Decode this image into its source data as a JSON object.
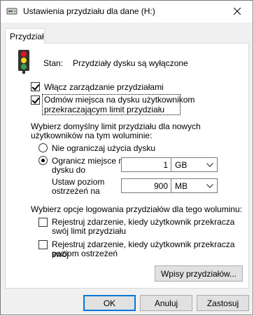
{
  "window": {
    "title": "Ustawienia przydziału dla dane (H:)",
    "close_label": "✕"
  },
  "tabs": [
    {
      "label": "Przydział",
      "active": true
    }
  ],
  "status": {
    "label": "Stan:",
    "value": "Przydziały dysku są wyłączone",
    "icon": "traffic-light-icon"
  },
  "options": {
    "enable": {
      "label": "Włącz zarządzanie przydziałami",
      "checked": true
    },
    "deny_line1": "Odmów miejsca na dysku użytkownikom",
    "deny_line2": "przekraczającym limit przydziału",
    "deny_checked": true
  },
  "default_limit": {
    "heading_line1": "Wybierz domyślny limit przydziału dla nowych",
    "heading_line2": "użytkowników na tym woluminie:",
    "no_limit_label": "Nie ograniczaj użycia dysku",
    "no_limit_selected": false,
    "limit_line1": "Ogranicz miejsce na",
    "limit_line2": "dysku do",
    "limit_selected": true,
    "limit_value": "1",
    "limit_unit": "GB",
    "warn_line1": "Ustaw poziom",
    "warn_line2": "ostrzeżeń na",
    "warn_value": "900",
    "warn_unit": "MB"
  },
  "logging": {
    "heading": "Wybierz opcje logowania przydziałów dla tego woluminu:",
    "limit_line1": "Rejestruj zdarzenie, kiedy użytkownik przekracza",
    "limit_line2": "swój limit przydziału",
    "limit_checked": false,
    "warn_line1": "Rejestruj zdarzenie, kiedy użytkownik przekracza swój",
    "warn_line2": "poziom ostrzeżeń",
    "warn_checked": false
  },
  "entries_button": "Wpisy przydziałów...",
  "footer": {
    "ok": "OK",
    "cancel": "Anuluj",
    "apply": "Zastosuj"
  },
  "colors": {
    "accent": "#0078d7",
    "red_light": "#e81123",
    "yellow_light": "#f7d51c",
    "green_light": "#3aa14a"
  }
}
